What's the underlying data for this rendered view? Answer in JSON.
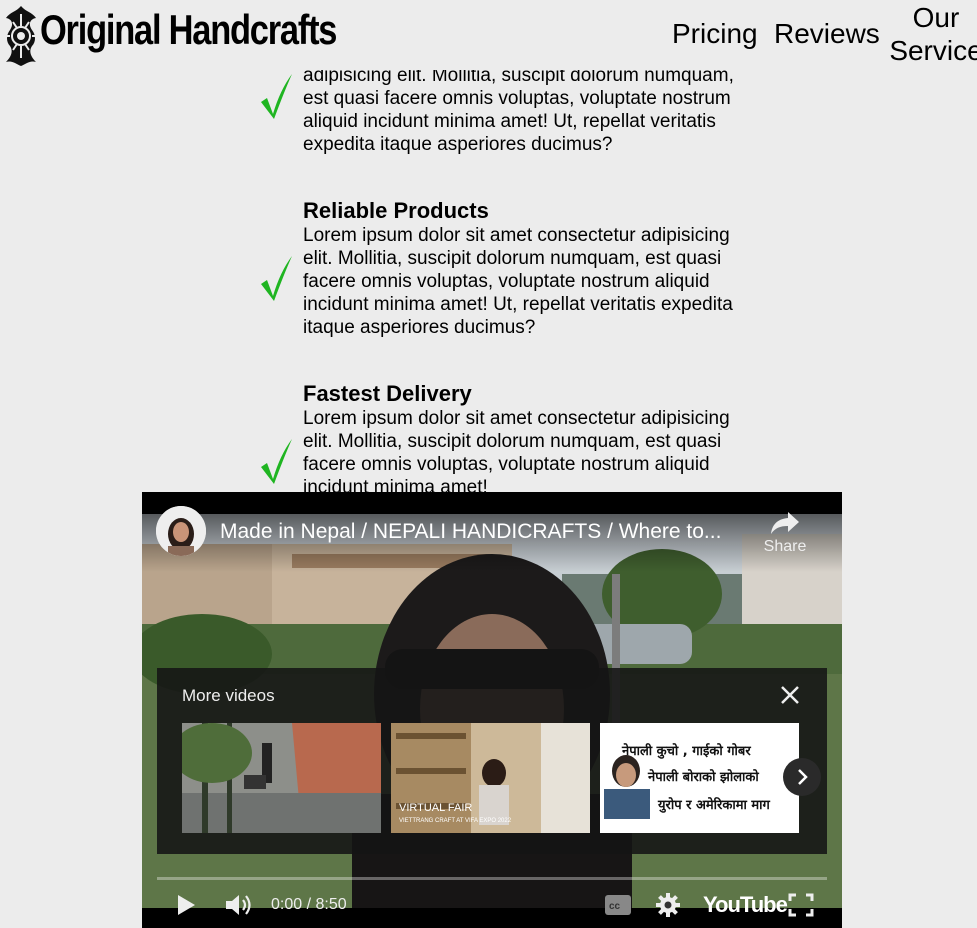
{
  "header": {
    "brand": "Original Handcrafts",
    "nav": {
      "pricing": "Pricing",
      "reviews": "Reviews",
      "services_line1": "Our",
      "services_line2": "Service"
    }
  },
  "features": [
    {
      "title": "",
      "text": "adipisicing elit. Mollitia, suscipit dolorum numquam, est quasi facere omnis voluptas, voluptate nostrum aliquid incidunt minima amet! Ut, repellat veritatis expedita itaque asperiores ducimus?"
    },
    {
      "title": "Reliable Products",
      "text": "Lorem ipsum dolor sit amet consectetur adipisicing elit. Mollitia, suscipit dolorum numquam, est quasi facere omnis voluptas, voluptate nostrum aliquid incidunt minima amet! Ut, repellat veritatis expedita itaque asperiores ducimus?"
    },
    {
      "title": "Fastest Delivery",
      "text": "Lorem ipsum dolor sit amet consectetur adipisicing elit. Mollitia, suscipit dolorum numquam, est quasi facere omnis voluptas, voluptate nostrum aliquid incidunt minima amet!"
    }
  ],
  "video": {
    "title": "Made in Nepal / NEPALI HANDICRAFTS / Where to...",
    "share_label": "Share",
    "more_videos_label": "More videos",
    "thumb2_caption_1": "VIRTUAL FAIR",
    "thumb2_caption_2": "VIETTRANG CRAFT AT VIFA EXPO 2022",
    "thumb3_lines": [
      "नेपाली कुचो , गाईको गोबर",
      "नेपाली बोराको झोलाको",
      "युरोप र अमेरिकामा माग"
    ],
    "time": "0:00 / 8:50",
    "platform": "YouTube",
    "progress": 0
  },
  "colors": {
    "check": "#1fb521",
    "page_bg": "#ececec"
  }
}
